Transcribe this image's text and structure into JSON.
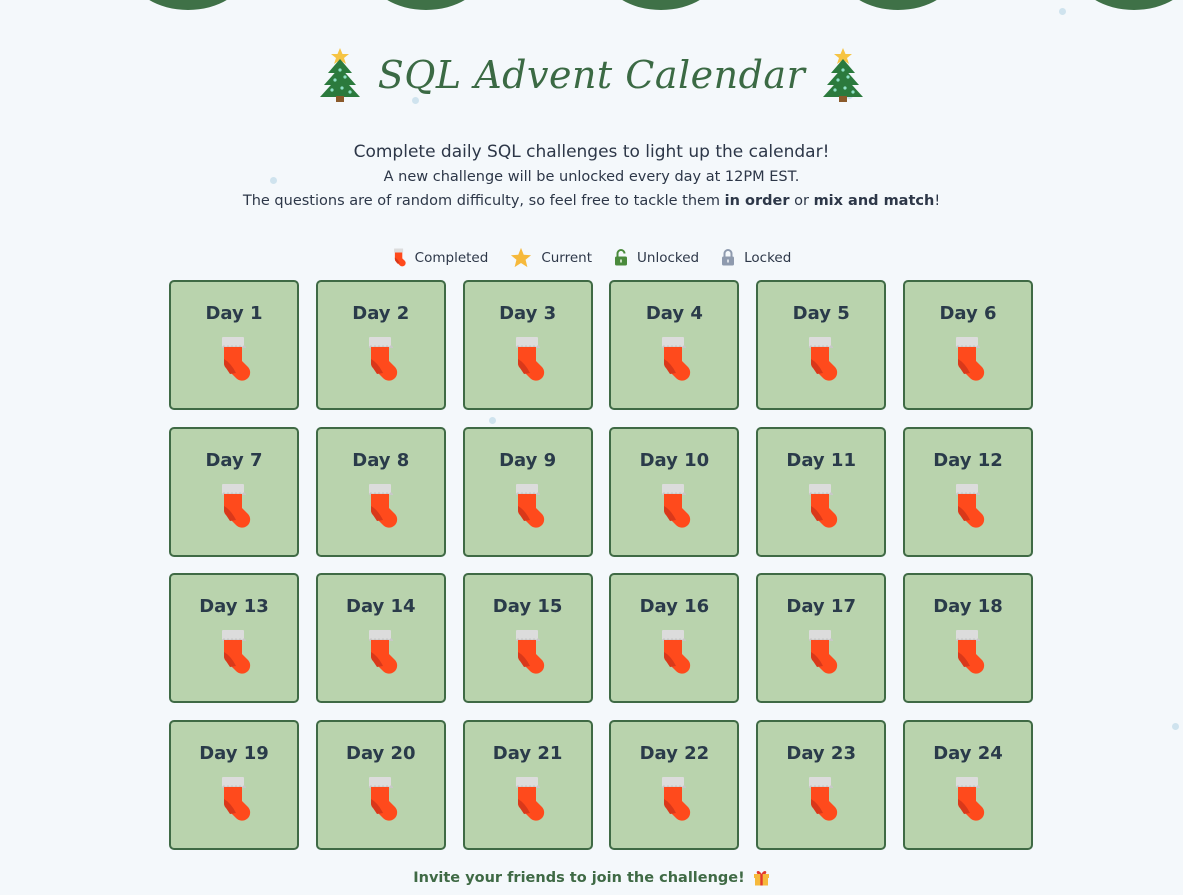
{
  "header": {
    "title": "SQL Advent Calendar",
    "tree_icon": "christmas-tree-icon"
  },
  "intro": {
    "line1": "Complete daily SQL challenges to light up the calendar!",
    "line2": "A new challenge will be unlocked every day at 12PM EST.",
    "line3_prefix": "The questions are of random difficulty, so feel free to tackle them ",
    "line3_bold1": "in order",
    "line3_mid": " or ",
    "line3_bold2": "mix and match",
    "line3_suffix": "!"
  },
  "legend": {
    "completed": "Completed",
    "current": "Current",
    "unlocked": "Unlocked",
    "locked": "Locked"
  },
  "days": [
    {
      "label": "Day 1",
      "status": "completed"
    },
    {
      "label": "Day 2",
      "status": "completed"
    },
    {
      "label": "Day 3",
      "status": "completed"
    },
    {
      "label": "Day 4",
      "status": "completed"
    },
    {
      "label": "Day 5",
      "status": "completed"
    },
    {
      "label": "Day 6",
      "status": "completed"
    },
    {
      "label": "Day 7",
      "status": "completed"
    },
    {
      "label": "Day 8",
      "status": "completed"
    },
    {
      "label": "Day 9",
      "status": "completed"
    },
    {
      "label": "Day 10",
      "status": "completed"
    },
    {
      "label": "Day 11",
      "status": "completed"
    },
    {
      "label": "Day 12",
      "status": "completed"
    },
    {
      "label": "Day 13",
      "status": "completed"
    },
    {
      "label": "Day 14",
      "status": "completed"
    },
    {
      "label": "Day 15",
      "status": "completed"
    },
    {
      "label": "Day 16",
      "status": "completed"
    },
    {
      "label": "Day 17",
      "status": "completed"
    },
    {
      "label": "Day 18",
      "status": "completed"
    },
    {
      "label": "Day 19",
      "status": "completed"
    },
    {
      "label": "Day 20",
      "status": "completed"
    },
    {
      "label": "Day 21",
      "status": "completed"
    },
    {
      "label": "Day 22",
      "status": "completed"
    },
    {
      "label": "Day 23",
      "status": "completed"
    },
    {
      "label": "Day 24",
      "status": "completed"
    }
  ],
  "footer": {
    "invite_text": "Invite your friends to join the challenge!",
    "gift_icon": "gift-icon"
  },
  "colors": {
    "background": "#f4f8fb",
    "accent_green": "#3f6a45",
    "tile_green": "#b9d3ad",
    "stocking_red": "#ff4a1c"
  }
}
